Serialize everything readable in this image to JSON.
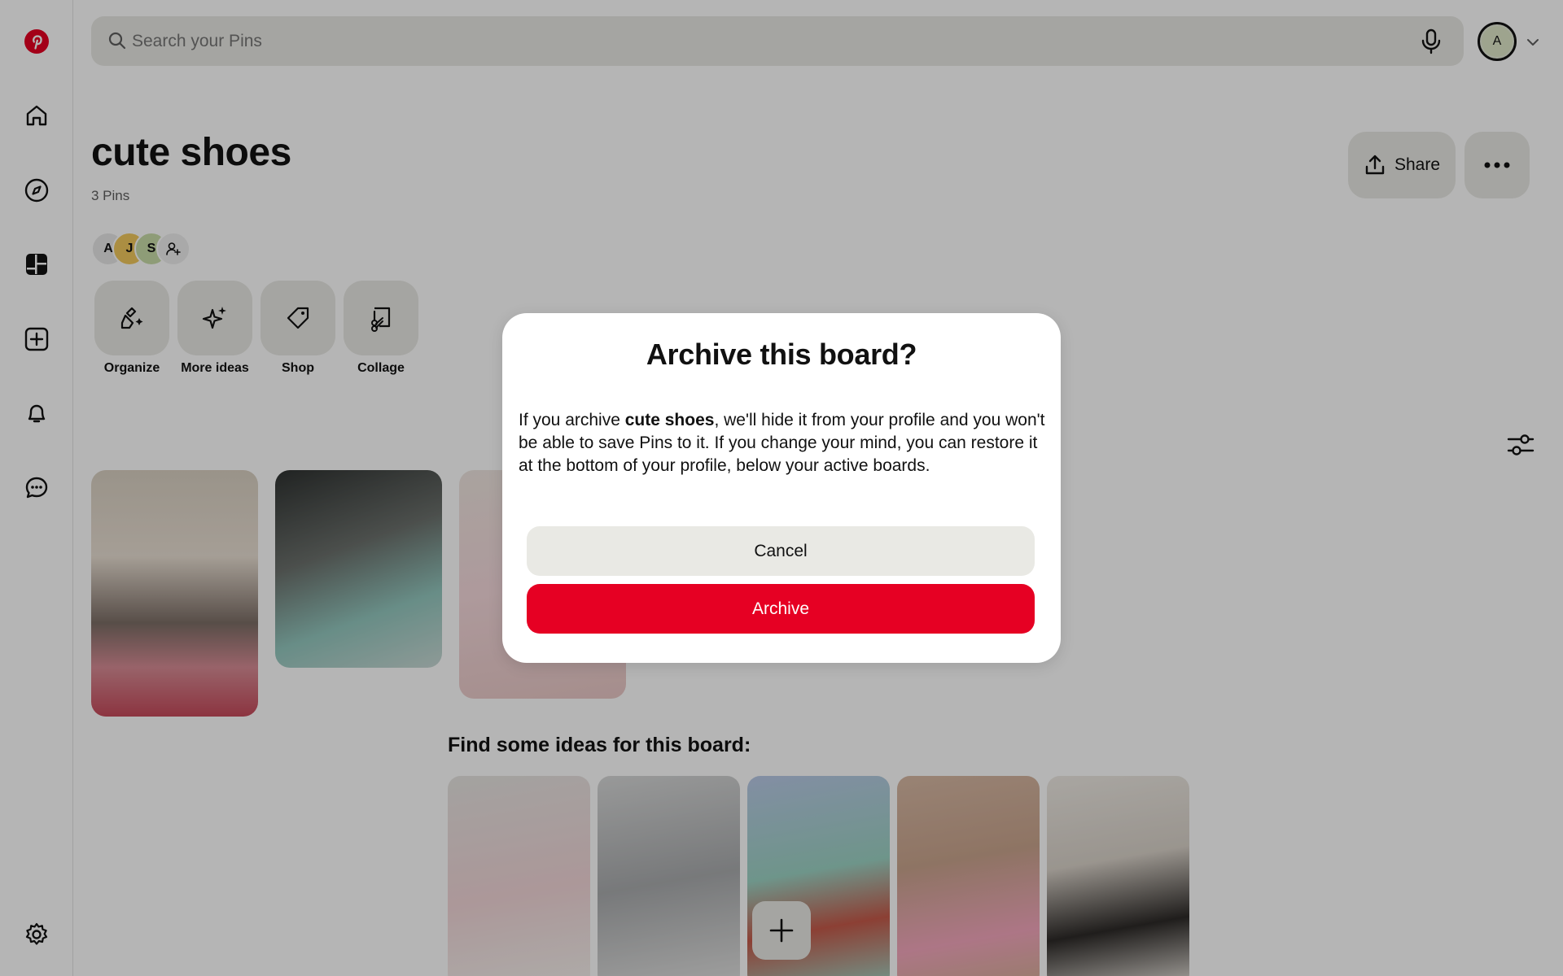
{
  "search": {
    "placeholder": "Search your Pins"
  },
  "account": {
    "initial": "A"
  },
  "board": {
    "title": "cute shoes",
    "pin_count": "3 Pins",
    "collaborators": [
      "A",
      "J",
      "S"
    ]
  },
  "actions": {
    "share_label": "Share"
  },
  "tools": [
    {
      "label": "Organize",
      "icon": "broom-icon"
    },
    {
      "label": "More ideas",
      "icon": "sparkle-icon"
    },
    {
      "label": "Shop",
      "icon": "tag-icon"
    },
    {
      "label": "Collage",
      "icon": "collage-icon"
    }
  ],
  "ideas": {
    "heading": "Find some ideas for this board:"
  },
  "modal": {
    "title": "Archive this board?",
    "body_prefix": "If you archive ",
    "board_name": "cute shoes",
    "body_suffix": ", we'll hide it from your profile and you won't be able to save Pins to it. If you change your mind, you can restore it at the bottom of your profile, below your active boards.",
    "cancel_label": "Cancel",
    "archive_label": "Archive"
  },
  "colors": {
    "brand": "#e60023",
    "button_gray": "#e9e9e4",
    "overlay": "rgba(0,0,0,0.29)"
  }
}
